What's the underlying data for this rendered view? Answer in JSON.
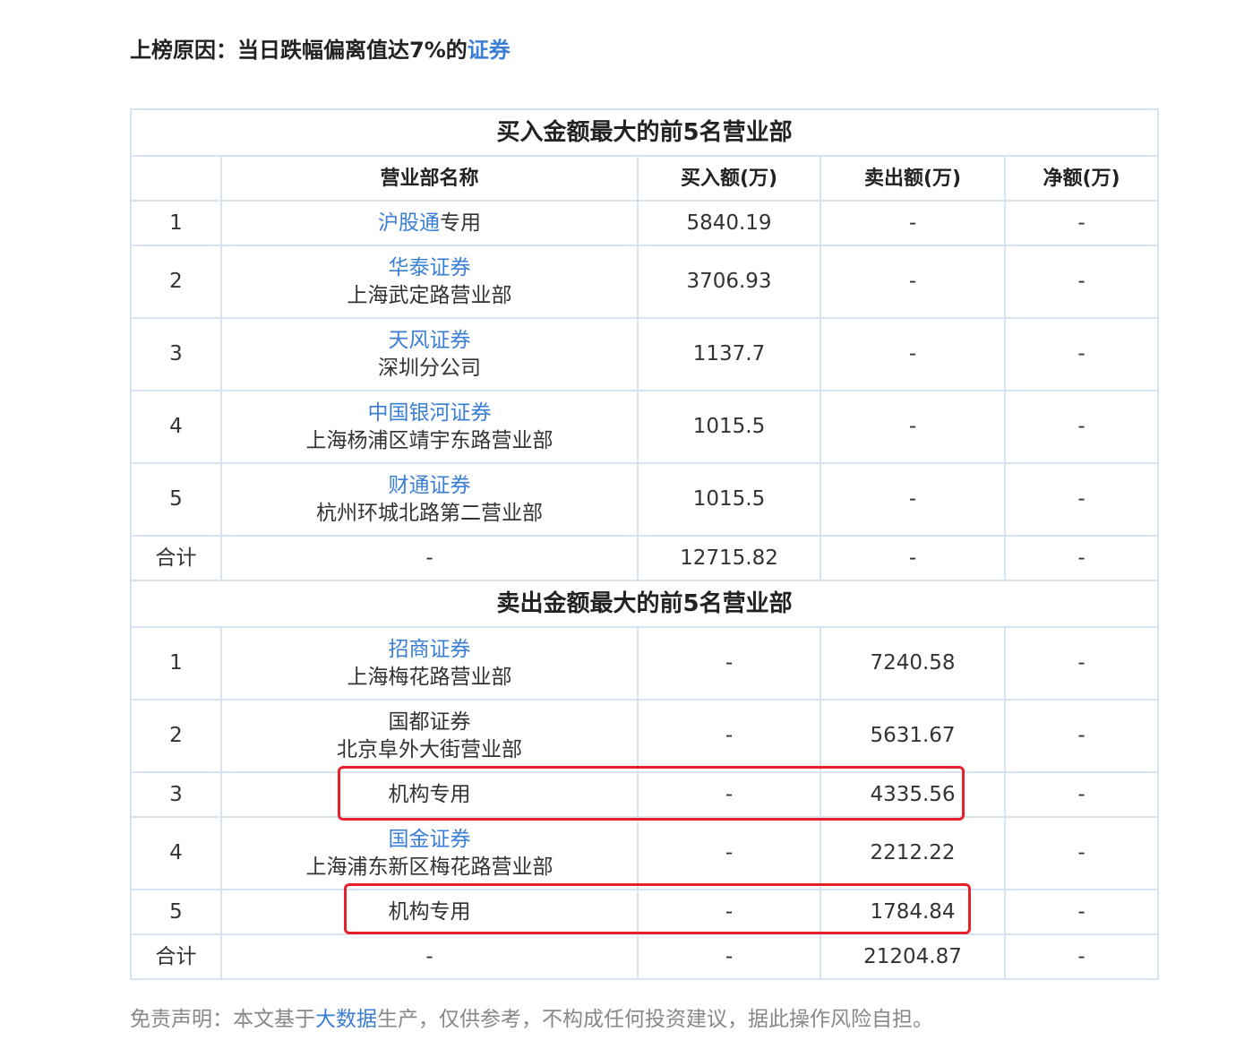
{
  "reason": {
    "prefix": "上榜原因：当日跌幅偏离值达7%的",
    "link": "证券"
  },
  "buy_section": {
    "title": "买入金额最大的前5名营业部",
    "headers": [
      "营业部名称",
      "买入额(万)",
      "卖出额(万)",
      "净额(万)"
    ],
    "rows": [
      {
        "rank": "1",
        "name_link": "沪股通",
        "name_suffix": "专用",
        "name_sub": "",
        "buy": "5840.19",
        "sell": "-",
        "net": "-"
      },
      {
        "rank": "2",
        "name_link": "华泰证券",
        "name_suffix": "",
        "name_sub": "上海武定路营业部",
        "buy": "3706.93",
        "sell": "-",
        "net": "-"
      },
      {
        "rank": "3",
        "name_link": "天风证券",
        "name_suffix": "",
        "name_sub": "深圳分公司",
        "buy": "1137.7",
        "sell": "-",
        "net": "-"
      },
      {
        "rank": "4",
        "name_link": "中国银河证券",
        "name_suffix": "",
        "name_sub": "上海杨浦区靖宇东路营业部",
        "buy": "1015.5",
        "sell": "-",
        "net": "-"
      },
      {
        "rank": "5",
        "name_link": "财通证券",
        "name_suffix": "",
        "name_sub": "杭州环城北路第二营业部",
        "buy": "1015.5",
        "sell": "-",
        "net": "-"
      }
    ],
    "total": {
      "label": "合计",
      "name": "-",
      "buy": "12715.82",
      "sell": "-",
      "net": "-"
    }
  },
  "sell_section": {
    "title": "卖出金额最大的前5名营业部",
    "rows": [
      {
        "rank": "1",
        "name_link": "招商证券",
        "name_plain": "",
        "name_sub": "上海梅花路营业部",
        "buy": "-",
        "sell": "7240.58",
        "net": "-"
      },
      {
        "rank": "2",
        "name_link": "",
        "name_plain": "国都证券",
        "name_sub": "北京阜外大街营业部",
        "buy": "-",
        "sell": "5631.67",
        "net": "-"
      },
      {
        "rank": "3",
        "name_link": "",
        "name_plain": "机构专用",
        "name_sub": "",
        "buy": "-",
        "sell": "4335.56",
        "net": "-"
      },
      {
        "rank": "4",
        "name_link": "国金证券",
        "name_plain": "",
        "name_sub": "上海浦东新区梅花路营业部",
        "buy": "-",
        "sell": "2212.22",
        "net": "-"
      },
      {
        "rank": "5",
        "name_link": "",
        "name_plain": "机构专用",
        "name_sub": "",
        "buy": "-",
        "sell": "1784.84",
        "net": "-"
      }
    ],
    "total": {
      "label": "合计",
      "name": "-",
      "buy": "-",
      "sell": "21204.87",
      "net": "-"
    }
  },
  "disclaimer": {
    "prefix": "免责声明：本文基于",
    "link": "大数据",
    "suffix": "生产，仅供参考，不构成任何投资建议，据此操作风险自担。"
  },
  "colors": {
    "link": "#3a7fd5",
    "border": "#d6e4f2",
    "highlight": "#e8202a"
  }
}
